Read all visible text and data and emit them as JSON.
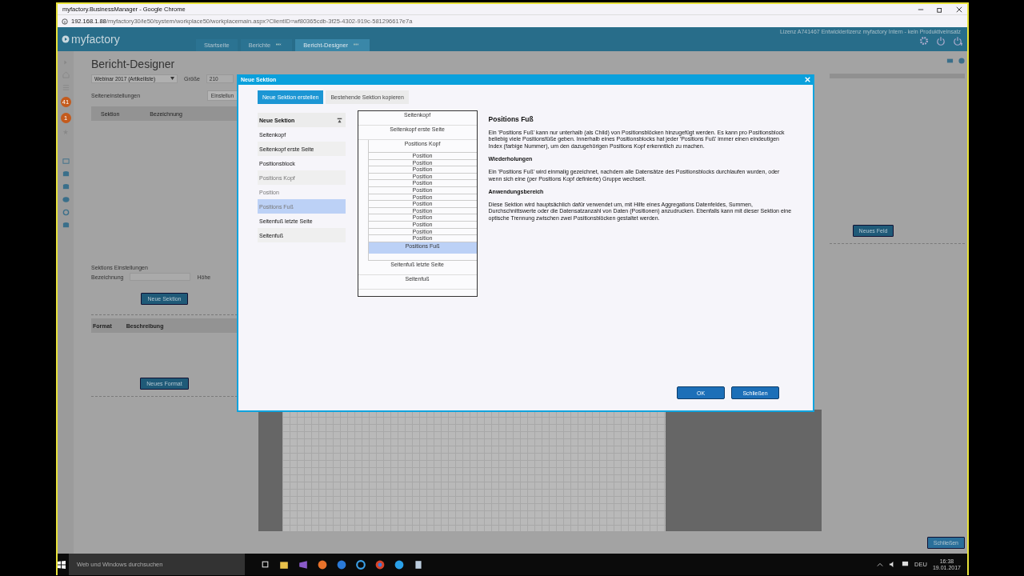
{
  "browser": {
    "title": "myfactory.BusinessManager - Google Chrome",
    "url_host": "192.168.1.88",
    "url_path": "/myfactory30/ie50/system/workplace50/workplacemain.aspx?ClientID=wf80365cdb-3f25-4302-919c-581296617e7a"
  },
  "app": {
    "logo": "myfactory",
    "license": "Lizenz A741467 Entwicklerlizenz myfactory Intern - kein Produktiveinsatz",
    "tabs": [
      {
        "label": "Startseite",
        "selected": false,
        "closable": false
      },
      {
        "label": "Berichte",
        "selected": false,
        "closable": true
      },
      {
        "label": "Bericht-Designer",
        "selected": true,
        "closable": true
      }
    ]
  },
  "sidebar_badges": [
    "41",
    "1"
  ],
  "designer": {
    "title": "Bericht-Designer",
    "report_select": "Webinar 2017 (Artikelliste)",
    "size_label": "Größe",
    "size_value": "210",
    "page_settings_label": "Seiteneinstellungen",
    "settings_button": "Einstellun",
    "section_columns": [
      "Sektion",
      "Bezeichnung"
    ],
    "section_settings_title": "Sektions Einstellungen",
    "name_label": "Bezeichnung",
    "height_label": "Höhe",
    "new_section_button": "Neue Sektion",
    "format_columns": [
      "Format",
      "Beschreibung"
    ],
    "new_format_button": "Neues Format",
    "new_field_button": "Neues Feld",
    "close_button": "Schließen"
  },
  "dialog": {
    "title": "Neue Sektion",
    "tabs": [
      {
        "label": "Neue Sektion erstellen",
        "selected": true
      },
      {
        "label": "Bestehende Sektion kopieren",
        "selected": false
      }
    ],
    "list_header": "Neue Sektion",
    "items": [
      {
        "label": "Seitenkopf",
        "selected": false,
        "disabled": false
      },
      {
        "label": "Seitenkopf erste Seite",
        "selected": false,
        "disabled": false
      },
      {
        "label": "Positionsblock",
        "selected": false,
        "disabled": false
      },
      {
        "label": "Positions Kopf",
        "selected": false,
        "disabled": true
      },
      {
        "label": "Position",
        "selected": false,
        "disabled": true
      },
      {
        "label": "Positions Fuß",
        "selected": true,
        "disabled": true
      },
      {
        "label": "Seitenfuß letzte Seite",
        "selected": false,
        "disabled": false
      },
      {
        "label": "Seitenfuß",
        "selected": false,
        "disabled": false
      }
    ],
    "preview": [
      {
        "kind": "section",
        "label": "Seitenkopf",
        "selected": false
      },
      {
        "kind": "section",
        "label": "Seitenkopf erste Seite",
        "selected": false
      },
      {
        "kind": "block",
        "children": [
          {
            "kind": "head",
            "label": "Positions Kopf",
            "selected": false
          },
          {
            "kind": "line",
            "label": "Position",
            "selected": false
          },
          {
            "kind": "line",
            "label": "Position",
            "selected": false
          },
          {
            "kind": "line",
            "label": "Position",
            "selected": false
          },
          {
            "kind": "line",
            "label": "Position",
            "selected": false
          },
          {
            "kind": "line",
            "label": "Position",
            "selected": false
          },
          {
            "kind": "line",
            "label": "Position",
            "selected": false
          },
          {
            "kind": "line",
            "label": "Position",
            "selected": false
          },
          {
            "kind": "line",
            "label": "Position",
            "selected": false
          },
          {
            "kind": "line",
            "label": "Position",
            "selected": false
          },
          {
            "kind": "line",
            "label": "Position",
            "selected": false
          },
          {
            "kind": "line",
            "label": "Position",
            "selected": false
          },
          {
            "kind": "line",
            "label": "Position",
            "selected": false
          },
          {
            "kind": "line",
            "label": "Position",
            "selected": false
          },
          {
            "kind": "foot",
            "label": "Positions Fuß",
            "selected": true
          }
        ]
      },
      {
        "kind": "section",
        "label": "Seitenfuß letzte Seite",
        "selected": false
      },
      {
        "kind": "section",
        "label": "Seitenfuß",
        "selected": false
      }
    ],
    "description": {
      "title": "Positions Fuß",
      "paragraphs": [
        {
          "kind": "text",
          "text": "Ein 'Positions Fuß' kann nur unterhalb (als Child) von Positionsblöcken hinzugefügt werden. Es kann pro Positionsblock beliebig viele Positionsfüße geben. Innerhalb eines Positionsblocks hat jeder 'Positions Fuß' immer einen eindeutigen Index (farbige Nummer), um den dazugehörigen Positions Kopf erkenntlich zu machen."
        },
        {
          "kind": "heading",
          "text": "Wiederholungen"
        },
        {
          "kind": "text",
          "text": "Ein 'Positions Fuß' wird einmalig gezeichnet, nachdem alle Datensätze des Positionsblocks durchlaufen wurden, oder wenn sich eine (per Positions Kopf definierte) Gruppe wechselt."
        },
        {
          "kind": "heading",
          "text": "Anwendungsbereich"
        },
        {
          "kind": "text",
          "text": "Diese Sektion wird hauptsächlich dafür verwendet um, mit Hilfe eines Aggregations Datenfeldes, Summen, Durchschnittswerte oder die Datensatzanzahl von Daten (Positionen) anzudrucken. Ebenfalls kann mit dieser Sektion eine optische Trennung zwischen zwei Positionsblöcken gestaltet werden."
        }
      ]
    },
    "ok_button": "OK",
    "close_button": "Schließen"
  },
  "taskbar": {
    "search_placeholder": "Web und Windows durchsuchen",
    "language": "DEU",
    "time": "16:38",
    "date": "19.01.2017"
  }
}
